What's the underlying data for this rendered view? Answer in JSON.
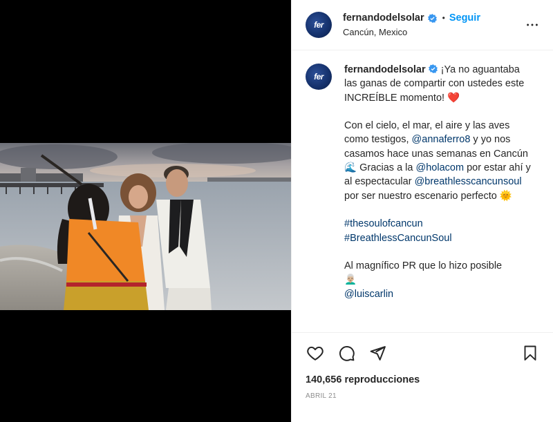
{
  "author": {
    "username": "fernandodelsolar",
    "avatar_text": "fer",
    "location": "Cancún, Mexico"
  },
  "header": {
    "dot": "•",
    "follow_label": "Seguir",
    "more_icon": "more-horizontal-icon"
  },
  "caption": {
    "intro": "¡Ya no aguantaba las ganas de compartir con ustedes este INCREÍBLE momento!",
    "heart_emoji": "❤️",
    "p2_a": "Con el cielo, el mar, el aire y las aves como testigos,",
    "mention_1": "@annaferro8",
    "p2_b": "y yo nos casamos hace unas semanas en Cancún",
    "wave_emoji": "🌊",
    "p2_c": "Gracias a la",
    "mention_2": "@holacom",
    "p2_d": "por estar ahí y al espectacular",
    "mention_3": "@breathlesscancunsoul",
    "p2_e": "por ser nuestro escenario perfecto",
    "sun_emoji": "🌞",
    "hashtag_1": "#thesoulofcancun",
    "hashtag_2": "#BreathlessCancunSoul",
    "p4": "Al magnífico PR que lo hizo posible",
    "person_emoji": "👨🏼‍🦳",
    "mention_4": "@luiscarlin"
  },
  "actions": {
    "like_icon": "heart-icon",
    "comment_icon": "comment-icon",
    "share_icon": "share-icon",
    "save_icon": "bookmark-icon"
  },
  "stats": {
    "views": "140,656 reproducciones",
    "date": "ABRIL 21"
  },
  "colors": {
    "link_blue": "#0095f6",
    "mention": "#00376b",
    "text": "#262626",
    "muted": "#8e8e8e",
    "verified": "#3897f0"
  }
}
